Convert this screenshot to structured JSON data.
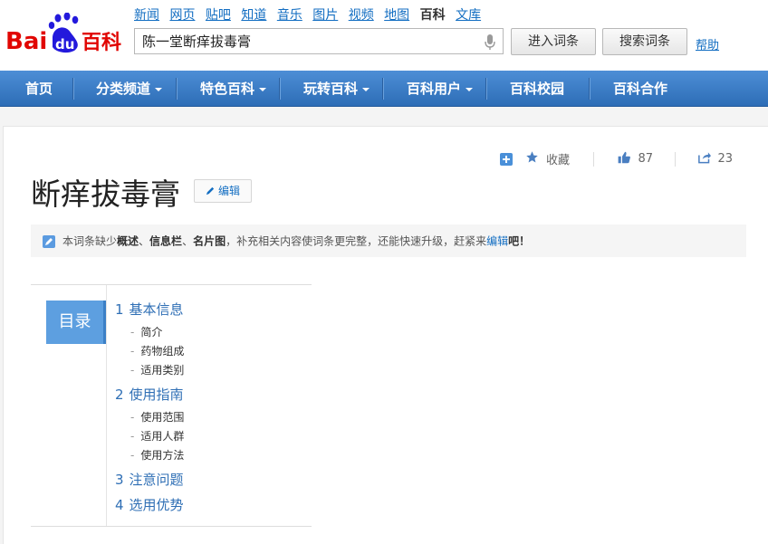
{
  "logo": {
    "bai": "Bai",
    "du": "du",
    "baike": "百科"
  },
  "top_nav": [
    {
      "label": "新闻"
    },
    {
      "label": "网页"
    },
    {
      "label": "贴吧"
    },
    {
      "label": "知道"
    },
    {
      "label": "音乐"
    },
    {
      "label": "图片"
    },
    {
      "label": "视频"
    },
    {
      "label": "地图"
    },
    {
      "label": "百科",
      "active": true
    },
    {
      "label": "文库"
    }
  ],
  "search": {
    "value": "陈一堂断痒拔毒膏",
    "enter_label": "进入词条",
    "search_label": "搜索词条",
    "help_label": "帮助"
  },
  "main_nav": [
    {
      "label": "首页"
    },
    {
      "label": "分类频道",
      "dropdown": true
    },
    {
      "label": "特色百科",
      "dropdown": true
    },
    {
      "label": "玩转百科",
      "dropdown": true
    },
    {
      "label": "百科用户",
      "dropdown": true
    },
    {
      "label": "百科校园"
    },
    {
      "label": "百科合作"
    }
  ],
  "entry": {
    "title": "断痒拔毒膏",
    "edit_label": "编辑",
    "collect_label": "收藏",
    "like_count": "87",
    "share_count": "23"
  },
  "notice": {
    "prefix": "本词条缺少",
    "item1": "概述",
    "sep1": "、",
    "item2": "信息栏",
    "sep2": "、",
    "item3": "名片图",
    "middle": "，补充相关内容使词条更完整，还能快速升级，赶紧来",
    "link": "编辑",
    "suffix": "吧！"
  },
  "catalog": {
    "heading": "目录",
    "sections": [
      {
        "num": "1",
        "title": "基本信息",
        "items": [
          "简介",
          "药物组成",
          "适用类别"
        ]
      },
      {
        "num": "2",
        "title": "使用指南",
        "items": [
          "使用范围",
          "适用人群",
          "使用方法"
        ]
      },
      {
        "num": "3",
        "title": "注意问题",
        "items": []
      },
      {
        "num": "4",
        "title": "选用优势",
        "items": []
      }
    ]
  },
  "colors": {
    "nav_blue": "#2d6db6",
    "link_blue": "#136ec2",
    "catalog_blue": "#5d9fe0",
    "logo_red": "#e10602",
    "logo_blue": "#2319dc"
  }
}
